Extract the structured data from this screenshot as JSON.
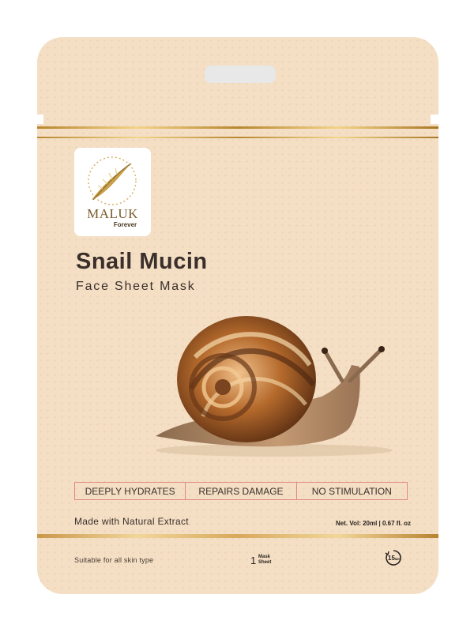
{
  "brand": {
    "name": "MALUK",
    "tagline": "Forever"
  },
  "product": {
    "title": "Snail Mucin",
    "subtitle": "Face Sheet Mask"
  },
  "features": [
    "DEEPLY HYDRATES",
    "REPAIRS DAMAGE",
    "NO STIMULATION"
  ],
  "claim": "Made with Natural Extract",
  "net_volume": "Net. Vol: 20ml | 0.67 fl. oz",
  "suitability": "Suitable for all skin type",
  "count": {
    "number": "1",
    "label_line1": "Mask",
    "label_line2": "Sheet"
  },
  "timer": {
    "minutes": "15",
    "unit": "MIN"
  },
  "colors": {
    "background": "#f4dfc5",
    "gold": "#d4a94e",
    "text": "#3a2f2a",
    "feature_border": "#e08a80"
  }
}
